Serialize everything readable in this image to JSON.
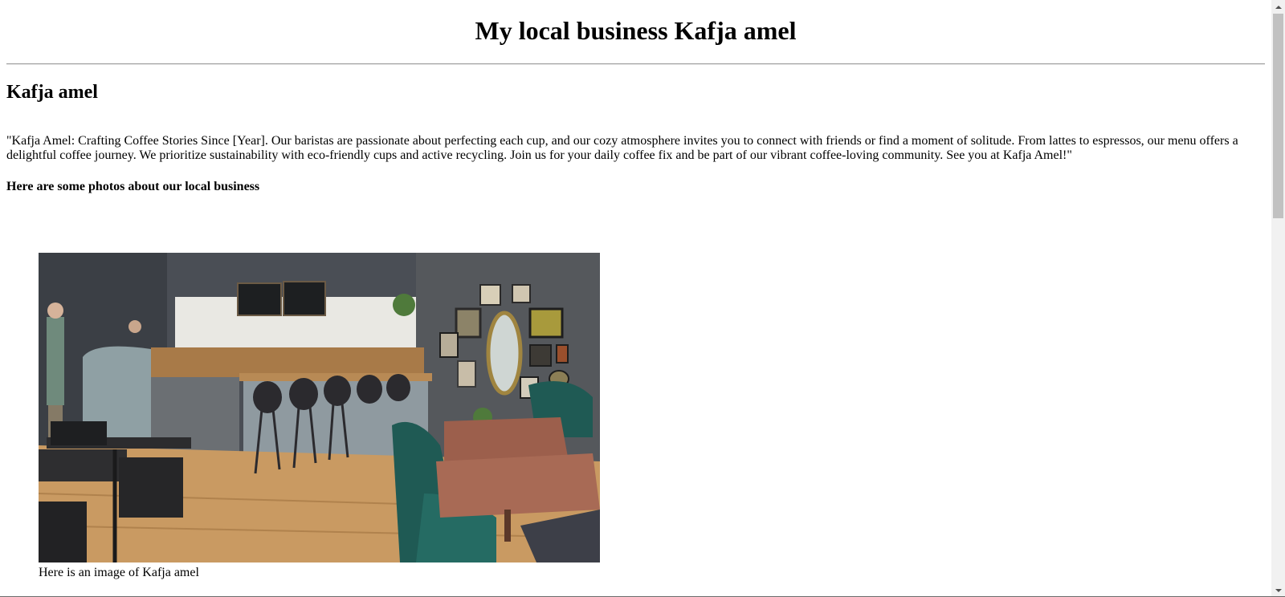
{
  "page": {
    "title": "My local business Kafja amel",
    "business_name": "Kafja amel",
    "description": "\"Kafja Amel: Crafting Coffee Stories Since [Year]. Our baristas are passionate about perfecting each cup, and our cozy atmosphere invites you to connect with friends or find a moment of solitude. From lattes to espressos, our menu offers a delightful coffee journey. We prioritize sustainability with eco-friendly cups and active recycling. Join us for your daily coffee fix and be part of our vibrant coffee-loving community. See you at Kafja Amel!\"",
    "photos_heading": "Here are some photos about our local business",
    "photo": {
      "caption": "Here is an image of Kafja amel"
    }
  },
  "scrollbar": {
    "icons": [
      "scroll-up-arrow-icon",
      "scroll-down-arrow-icon"
    ]
  }
}
